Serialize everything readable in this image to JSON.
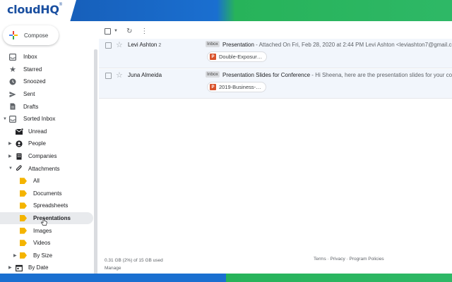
{
  "brand": {
    "name": "cloudHQ",
    "mark": "®"
  },
  "compose": {
    "label": "Compose"
  },
  "nav": {
    "items": [
      {
        "label": "Inbox",
        "icon": "inbox-icon"
      },
      {
        "label": "Starred",
        "icon": "star-icon"
      },
      {
        "label": "Snoozed",
        "icon": "clock-icon"
      },
      {
        "label": "Sent",
        "icon": "send-icon"
      },
      {
        "label": "Drafts",
        "icon": "draft-icon"
      },
      {
        "label": "Sorted Inbox",
        "icon": "sorted-inbox-icon"
      },
      {
        "label": "Unread",
        "icon": "unread-mail-icon"
      },
      {
        "label": "People",
        "icon": "person-icon"
      },
      {
        "label": "Companies",
        "icon": "building-icon"
      },
      {
        "label": "Attachments",
        "icon": "paperclip-icon"
      },
      {
        "label": "All",
        "icon": "tag-icon"
      },
      {
        "label": "Documents",
        "icon": "tag-icon"
      },
      {
        "label": "Spreadsheets",
        "icon": "tag-icon"
      },
      {
        "label": "Presentations",
        "icon": "tag-icon"
      },
      {
        "label": "Images",
        "icon": "tag-icon"
      },
      {
        "label": "Videos",
        "icon": "tag-icon"
      },
      {
        "label": "By Size",
        "icon": "tag-icon"
      },
      {
        "label": "By Date",
        "icon": "calendar-icon"
      }
    ],
    "active": "Presentations"
  },
  "emails": [
    {
      "sender": "Levi Ashton",
      "count": "2",
      "label": "Inbox",
      "subject": "Presentation",
      "snippet": " - Attached On Fri, Feb 28, 2020 at 2:44 PM Levi Ashton <leviashton7@gmail.com>",
      "attachment": "Double-Exposur…"
    },
    {
      "sender": "Juna Almeida",
      "count": "",
      "label": "Inbox",
      "subject": "Presentation Slides for Conference",
      "snippet": " - Hi Sheena, here are the presentation slides for your conf",
      "attachment": "2019-Business-…"
    }
  ],
  "footer": {
    "storage": "0.31 GB (2%) of 15 GB used",
    "manage": "Manage",
    "links": "Terms · Privacy · Program Policies"
  },
  "colors": {
    "accent": "#1a73e8",
    "tag": "#f4b400",
    "attachment_icon": "#d9532c"
  }
}
